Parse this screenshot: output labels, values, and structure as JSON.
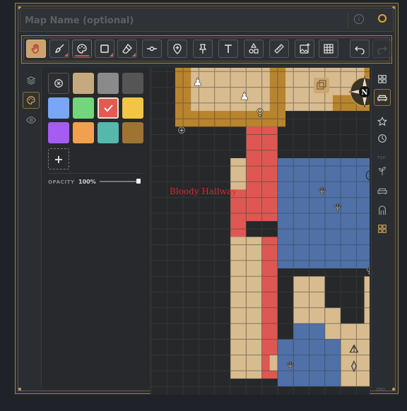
{
  "app": {
    "title_placeholder": "Map Name (optional)",
    "info_glyph": "i"
  },
  "toolbar": {
    "tools": [
      {
        "name": "pan-tool",
        "icon": "hand-icon",
        "active": true
      },
      {
        "name": "brush-tool",
        "icon": "brush-icon"
      },
      {
        "name": "color-tool",
        "icon": "palette-icon"
      },
      {
        "name": "shape-tool",
        "icon": "square-icon"
      },
      {
        "name": "eraser-tool",
        "icon": "eraser-icon"
      },
      {
        "name": "line-tool",
        "icon": "line-point-icon"
      },
      {
        "name": "marker-tool",
        "icon": "pin-add-icon"
      },
      {
        "name": "pushpin-tool",
        "icon": "pushpin-icon"
      },
      {
        "name": "text-tool",
        "icon": "text-icon"
      },
      {
        "name": "objects-tool",
        "icon": "shapes-icon"
      },
      {
        "name": "measure-tool",
        "icon": "ruler-icon"
      },
      {
        "name": "image-tool",
        "icon": "image-add-icon"
      },
      {
        "name": "grid-tool",
        "icon": "grid-icon"
      },
      {
        "name": "undo-button",
        "icon": "undo-icon"
      },
      {
        "name": "redo-button",
        "icon": "redo-icon"
      }
    ]
  },
  "palette": {
    "swatches": [
      {
        "name": "clear",
        "color": ""
      },
      {
        "name": "tan",
        "color": "#c6aa7f"
      },
      {
        "name": "gray",
        "color": "#8a8a8a"
      },
      {
        "name": "dark-gray",
        "color": "#555555"
      },
      {
        "name": "blue",
        "color": "#79a6f7"
      },
      {
        "name": "green",
        "color": "#73d57c"
      },
      {
        "name": "red",
        "color": "#e45a52",
        "selected": true
      },
      {
        "name": "yellow",
        "color": "#f3c544"
      },
      {
        "name": "purple",
        "color": "#a55cf0"
      },
      {
        "name": "orange",
        "color": "#f0a04e"
      },
      {
        "name": "teal",
        "color": "#55b8ab"
      },
      {
        "name": "brown",
        "color": "#9f7432"
      }
    ],
    "add_glyph": "+",
    "opacity_label": "OPACITY",
    "opacity_value": "100%",
    "opacity": 1.0
  },
  "map": {
    "label": "Bloody Hallway",
    "colors": {
      "tan": "#d8bb8e",
      "wall": "#b8842e",
      "red": "#df5752",
      "blue": "#4f71a8",
      "grid": "#3f4244",
      "bg": "#26282a"
    }
  },
  "right_panel": {
    "top_label": "TOP",
    "end_label": "END"
  }
}
